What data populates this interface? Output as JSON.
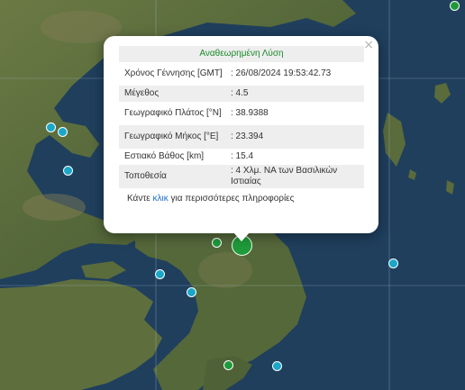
{
  "popup": {
    "title": "Αναθεωρημένη Λύση",
    "rows": [
      {
        "label": "Χρόνος Γέννησης [GMT]",
        "value": ": 26/08/2024 19:53:42.73"
      },
      {
        "label": "Μέγεθος",
        "value": ": 4.5"
      },
      {
        "label": "Γεωγραφικό Πλάτος [°N]",
        "value": ": 38.9388"
      },
      {
        "label": "Γεωγραφικό Μήκος [°E]",
        "value": ": 23.394"
      },
      {
        "label": "Εστιακό Βάθος [km]",
        "value": ": 15.4"
      },
      {
        "label": "Τοποθεσία",
        "value": ": 4 Χλμ. ΝΑ των Βασιλικών Ιστιαίας"
      }
    ],
    "more_prefix": "Κάντε ",
    "more_link": "κλικ",
    "more_suffix": " για περισσότερες πληροφορίες",
    "close_symbol": "×"
  },
  "colors": {
    "sea": "#1f3f5d",
    "land": "#5b6d3a",
    "marker_cyan": "#1aa7c9",
    "marker_green": "#1f9a3a",
    "popup_title": "#1a8a2a",
    "link": "#1a6fd1"
  }
}
